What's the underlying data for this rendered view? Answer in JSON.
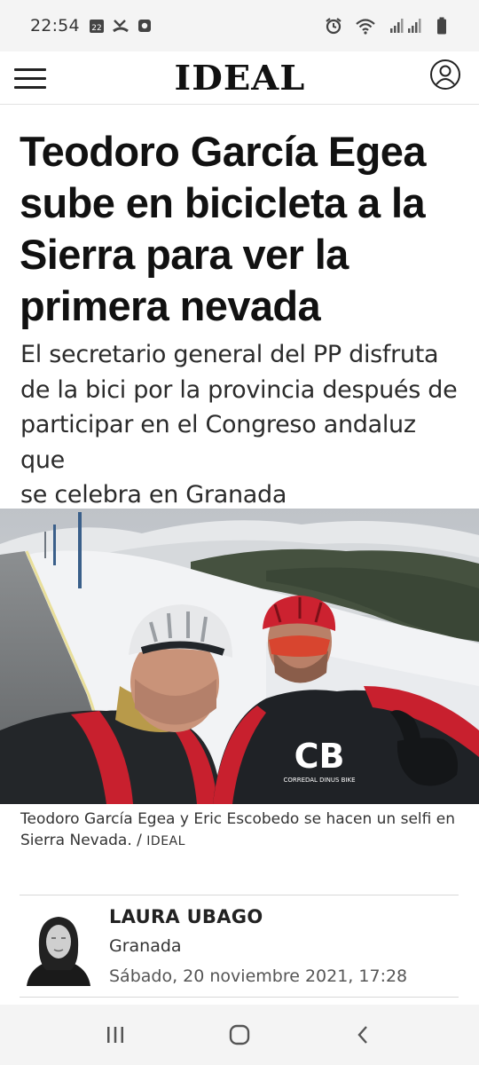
{
  "status_bar": {
    "time": "22:54",
    "calendar_day": "22"
  },
  "header": {
    "logo": "IDEAL"
  },
  "article": {
    "headline_lines": [
      "Teodoro García Egea",
      "sube en bicicleta a la",
      "Sierra para ver la",
      "primera nevada"
    ],
    "subtitle_lines": [
      "El secretario general del PP disfruta",
      "de la bici por la provincia después de",
      "participar en el Congreso andaluz que",
      "se celebra en Granada"
    ],
    "photo_jersey_text": "CB",
    "photo_jersey_subtext": "CORREDAL DINUS BIKE",
    "caption_line1": "Teodoro García Egea y Eric Escobedo se hacen un selfi en",
    "caption_line2": "Sierra Nevada. / ",
    "caption_credit": "IDEAL"
  },
  "author": {
    "name": "LAURA UBAGO",
    "city": "Granada",
    "date": "Sábado, 20 noviembre 2021, 17:28"
  },
  "colors": {
    "status_bg": "#f4f4f4",
    "text": "#111111",
    "jersey_red": "#c8202e",
    "snow": "#f2f3f5"
  },
  "icons": [
    "calendar-icon",
    "missed-call-icon",
    "notification-icon",
    "alarm-icon",
    "wifi-icon",
    "signal-icon",
    "battery-icon",
    "menu-icon",
    "user-icon",
    "recents-icon",
    "home-icon",
    "back-icon"
  ]
}
